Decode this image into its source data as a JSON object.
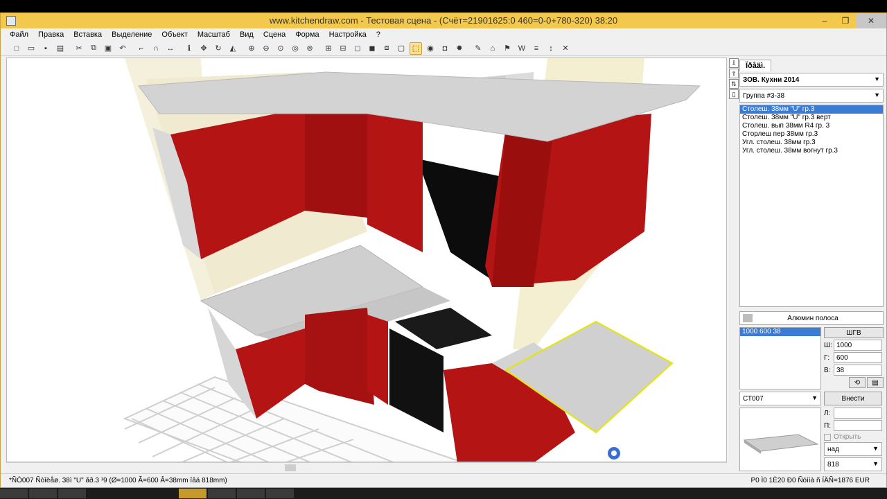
{
  "window": {
    "title": "www.kitchendraw.com - Тестовая сцена - (Счёт=21901625:0 460=0-0+780-320) 38:20",
    "controls": [
      "‒",
      "❐",
      "✕"
    ]
  },
  "menu": {
    "items": [
      "Файл",
      "Правка",
      "Вставка",
      "Выделение",
      "Объект",
      "Масштаб",
      "Вид",
      "Сцена",
      "Форма",
      "Настройка",
      "?"
    ]
  },
  "toolbar": {
    "icons": [
      {
        "name": "new-icon",
        "glyph": "□"
      },
      {
        "name": "open-icon",
        "glyph": "▭"
      },
      {
        "name": "save-icon",
        "glyph": "▪"
      },
      {
        "name": "print-icon",
        "glyph": "▤"
      },
      {
        "name": "cut-icon",
        "glyph": "✂"
      },
      {
        "name": "copy-icon",
        "glyph": "⧉"
      },
      {
        "name": "paste-icon",
        "glyph": "▣"
      },
      {
        "name": "undo-icon",
        "glyph": "↶"
      },
      {
        "name": "stairs-icon",
        "glyph": "⌐"
      },
      {
        "name": "magnet-icon",
        "glyph": "∩"
      },
      {
        "name": "measure-icon",
        "glyph": "↔"
      },
      {
        "name": "info-icon",
        "glyph": "ℹ"
      },
      {
        "name": "move-icon",
        "glyph": "✥"
      },
      {
        "name": "rotate-icon",
        "glyph": "↻"
      },
      {
        "name": "reflect-icon",
        "glyph": "◭"
      },
      {
        "name": "zoom-in-icon",
        "glyph": "⊕"
      },
      {
        "name": "zoom-out-icon",
        "glyph": "⊖"
      },
      {
        "name": "zoom-window-icon",
        "glyph": "⊙"
      },
      {
        "name": "zoom-all-icon",
        "glyph": "◎"
      },
      {
        "name": "zoom-prev-icon",
        "glyph": "⊚"
      },
      {
        "name": "plan-view-icon",
        "glyph": "⊞"
      },
      {
        "name": "elevation-icon",
        "glyph": "⊟"
      },
      {
        "name": "wireframe-icon",
        "glyph": "◻"
      },
      {
        "name": "shaded-icon",
        "glyph": "◼"
      },
      {
        "name": "hidden-line-icon",
        "glyph": "⧈"
      },
      {
        "name": "box-icon",
        "glyph": "▢"
      },
      {
        "name": "perspective-icon",
        "glyph": "⬚"
      },
      {
        "name": "camera-icon",
        "glyph": "◉"
      },
      {
        "name": "photo-icon",
        "glyph": "◘"
      },
      {
        "name": "light-icon",
        "glyph": "✹"
      },
      {
        "name": "tools-icon",
        "glyph": "✎"
      },
      {
        "name": "house-icon",
        "glyph": "⌂"
      },
      {
        "name": "flag-icon",
        "glyph": "⚑"
      },
      {
        "name": "w-icon",
        "glyph": "W"
      },
      {
        "name": "list-icon",
        "glyph": "≡"
      },
      {
        "name": "dims-icon",
        "glyph": "↕"
      },
      {
        "name": "close-scene-icon",
        "glyph": "✕"
      }
    ]
  },
  "side_tools": [
    "⇩",
    "⇧",
    "⇅",
    "▯"
  ],
  "panel": {
    "tab_label": "Ïðåäì.",
    "catalog": "ЗОВ. Кухни 2014",
    "group": "Группа #3-38",
    "items": [
      "Столеш. 38мм \"U\" гр.3",
      "Столеш. 38мм \"U\" гр.3 верт",
      "Столеш. вып 38мм R4 гр. 3",
      "Сторлеш пер 38мм гр.3",
      "Угл. столеш. 38мм гр.3",
      "Угл. столеш. 38мм вогнут гр.3"
    ],
    "finish_label": "Алюмин полоса",
    "dims_list": [
      "1000  600  38"
    ],
    "shgv_button": "ШГВ",
    "width_label": "Ш:",
    "width_value": "1000",
    "depth_label": "Г:",
    "depth_value": "600",
    "height_label": "В:",
    "height_value": "38",
    "code_value": "СТ007",
    "insert_button": "Внести",
    "left_label": "Л:",
    "right_label": "П:",
    "open_checkbox": "Открыть",
    "position_value": "над",
    "elevation_value": "818"
  },
  "status": {
    "left": "*ÑÒ007  Ñòîëåø. 38ì \"U\" ãð.3 ¹9  (Ø=1000 Ã=600 Â=38mm îâä 818mm)",
    "right": "Р0 Ì0 1È20 Ð0 Ñóììà ñ ÍÄÑ=1876 EUR"
  },
  "colors": {
    "title_bg": "#f2c94c",
    "cabinet_red": "#b51414",
    "countertop": "#cfcfcf",
    "selection": "#e6e600",
    "list_selection": "#3a7bd5"
  }
}
